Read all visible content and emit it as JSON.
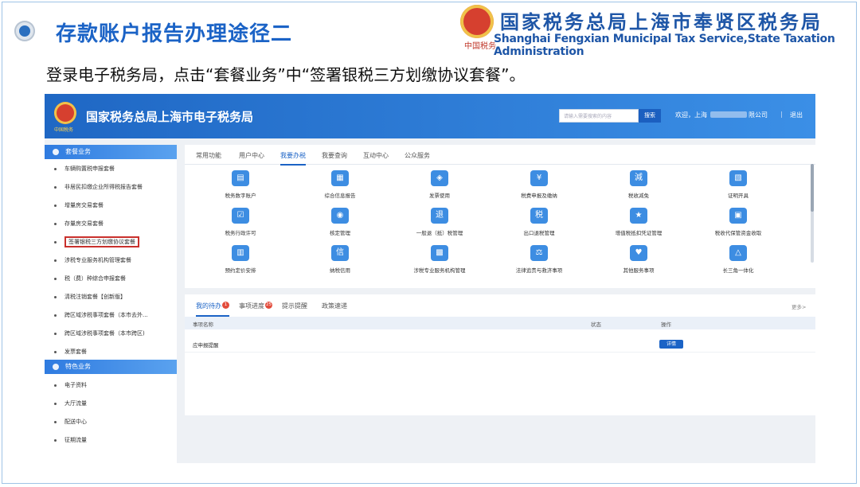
{
  "slide": {
    "title": "存款账户报告办理途径二",
    "instruction": "登录电子税务局，点击“套餐业务”中“签署银税三方划缴协议套餐”。",
    "org_cn": "国家税务总局上海市奉贤区税务局",
    "org_en": "Shanghai Fengxian Municipal Tax Service,State Taxation Administration",
    "emblem_sub": "中国税务"
  },
  "portal": {
    "title": "国家税务总局上海市电子税务局",
    "emblem_sub": "中国税务",
    "search_placeholder": "请输入需要搜索的内容",
    "search_button": "搜索",
    "greeting": "欢迎，上海",
    "company_suffix": "限公司",
    "separator": "|",
    "logout": "退出"
  },
  "sidebar": {
    "section1": "套餐业务",
    "items1": [
      "车辆购置税申报套餐",
      "非居民扣缴企业所得税报告套餐",
      "增量房交易套餐",
      "存量房交易套餐",
      "签署银税三方划缴协议套餐",
      "涉税专业服务机构管理套餐",
      "税（费）种综合申报套餐",
      "清税注销套餐【创新版】",
      "跨区域涉税事项套餐（本市去外...",
      "跨区域涉税事项套餐（本市跨区)",
      "发票套餐"
    ],
    "section2": "特色业务",
    "items2": [
      "电子资料",
      "大厅流量",
      "配送中心",
      "征期流量"
    ]
  },
  "main": {
    "tabs": [
      "常用功能",
      "用户中心",
      "我要办税",
      "我要查询",
      "互动中心",
      "公众服务"
    ],
    "services": [
      {
        "label": "税务数字账户",
        "icon": "▤"
      },
      {
        "label": "综合信息报告",
        "icon": "▦"
      },
      {
        "label": "发票使用",
        "icon": "◈"
      },
      {
        "label": "税费申报及缴纳",
        "icon": "¥"
      },
      {
        "label": "税收减免",
        "icon": "減"
      },
      {
        "label": "证明开具",
        "icon": "▧"
      },
      {
        "label": "税务行政许可",
        "icon": "☑"
      },
      {
        "label": "核定管理",
        "icon": "◉"
      },
      {
        "label": "一般退（抵）税管理",
        "icon": "退"
      },
      {
        "label": "出口退税管理",
        "icon": "税"
      },
      {
        "label": "增值税抵扣凭证管理",
        "icon": "★"
      },
      {
        "label": "税收代保管资金收取",
        "icon": "▣"
      },
      {
        "label": "预约定价安排",
        "icon": "▥"
      },
      {
        "label": "纳税信用",
        "icon": "信"
      },
      {
        "label": "涉税专业服务机构管理",
        "icon": "▩"
      },
      {
        "label": "法律追责与救济事项",
        "icon": "⚖"
      },
      {
        "label": "其他服务事项",
        "icon": "♥"
      },
      {
        "label": "长三角一体化",
        "icon": "△"
      }
    ]
  },
  "todo": {
    "tabs": [
      {
        "label": "我的待办",
        "badge": "1"
      },
      {
        "label": "事项进度",
        "badge": "25"
      },
      {
        "label": "提示提醒",
        "badge": ""
      },
      {
        "label": "政策速递",
        "badge": ""
      }
    ],
    "more": "更多>",
    "columns": [
      "事项名称",
      "状态",
      "操作"
    ],
    "rows": [
      {
        "name": "应申报提醒",
        "status": "",
        "action": "详情"
      }
    ]
  },
  "colors": {
    "accent": "#1b63c6",
    "highlight": "#c9302c",
    "header_from": "#1f67c4",
    "header_to": "#3b8fe6"
  }
}
